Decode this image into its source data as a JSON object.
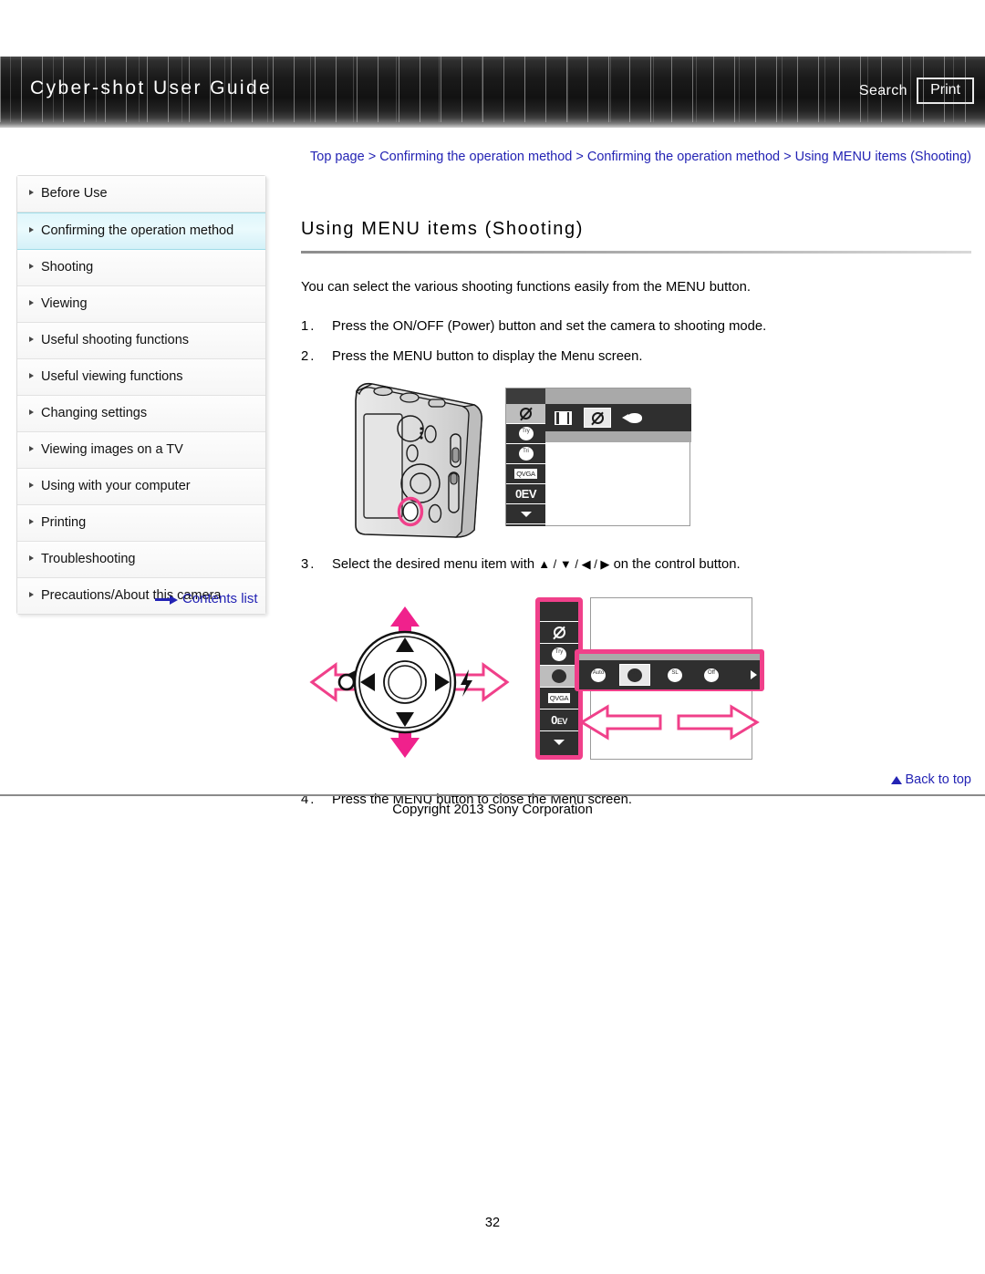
{
  "header": {
    "brand": "Cyber-shot User Guide",
    "search_label": "Search",
    "print_label": "Print"
  },
  "breadcrumb": {
    "text": "Top page > Confirming the operation method > Confirming the operation method > Using MENU items (Shooting)"
  },
  "sidebar": {
    "items": [
      {
        "label": "Before Use",
        "active": false
      },
      {
        "label": "Confirming the operation method",
        "active": true
      },
      {
        "label": "Shooting",
        "active": false
      },
      {
        "label": "Viewing",
        "active": false
      },
      {
        "label": "Useful shooting functions",
        "active": false
      },
      {
        "label": "Useful viewing functions",
        "active": false
      },
      {
        "label": "Changing settings",
        "active": false
      },
      {
        "label": "Viewing images on a TV",
        "active": false
      },
      {
        "label": "Using with your computer",
        "active": false
      },
      {
        "label": "Printing",
        "active": false
      },
      {
        "label": "Troubleshooting",
        "active": false
      },
      {
        "label": "Precautions/About this camera",
        "active": false
      }
    ],
    "contents_list_label": "Contents list"
  },
  "main": {
    "title": "Using MENU items (Shooting)",
    "intro": "You can select the various shooting functions easily from the MENU button.",
    "steps": [
      {
        "num": "1.",
        "text": "Press the ON/OFF (Power) button and set the camera to shooting mode."
      },
      {
        "num": "2.",
        "text": "Press the MENU button to display the Menu screen."
      },
      {
        "num": "3.",
        "text_before": "Select the desired menu item with",
        "arrows": "▲ / ▼ / ◀ / ▶",
        "text_after": "on the control button."
      },
      {
        "num": "4.",
        "text": "Press the MENU button to close the Menu screen."
      }
    ]
  },
  "menu_screen_1": {
    "left_column": [
      {
        "icon": "no-flash-icon",
        "label": "",
        "selected": true
      },
      {
        "icon": "self-timer-off-icon",
        "label": "Try",
        "selected": false
      },
      {
        "icon": "smile-shutter-icon",
        "label": "Tri",
        "selected": false
      },
      {
        "icon": "image-size-vga-icon",
        "label": "QVGA",
        "selected": false
      },
      {
        "icon": "exposure-value-icon",
        "label": "0EV",
        "selected": false
      },
      {
        "icon": "scroll-down-icon",
        "label": "",
        "selected": false
      }
    ],
    "top_row": [
      {
        "icon": "movie-film-icon",
        "selected": false
      },
      {
        "icon": "no-flash-icon",
        "selected": true
      },
      {
        "icon": "underwater-fish-icon",
        "selected": false
      }
    ]
  },
  "menu_screen_2": {
    "strip": [
      {
        "icon": "blank-icon",
        "selected": false
      },
      {
        "icon": "no-flash-icon",
        "selected": false
      },
      {
        "icon": "self-timer-icon",
        "selected": false
      },
      {
        "icon": "smile-shutter-icon",
        "selected": true
      },
      {
        "icon": "image-size-vga-icon",
        "selected": false
      },
      {
        "icon": "exposure-value-icon",
        "selected": false
      },
      {
        "icon": "scroll-down-icon",
        "selected": false
      }
    ],
    "flash_options": [
      {
        "icon": "flash-auto-icon",
        "selected": false
      },
      {
        "icon": "flash-on-icon",
        "selected": true
      },
      {
        "icon": "slow-sync-icon",
        "selected": false
      },
      {
        "icon": "flash-off-icon",
        "selected": false
      }
    ]
  },
  "control_button": {
    "self_timer_icon": "self-timer-icon",
    "flash_icon": "flash-icon"
  },
  "footer": {
    "back_to_top": "Back to top",
    "copyright": "Copyright 2013 Sony Corporation",
    "page_number": "32"
  },
  "colors": {
    "link": "#2323b4",
    "accent_pink": "#f0408a",
    "sidebar_active": "#dff6fb",
    "header_dark": "#121212"
  }
}
